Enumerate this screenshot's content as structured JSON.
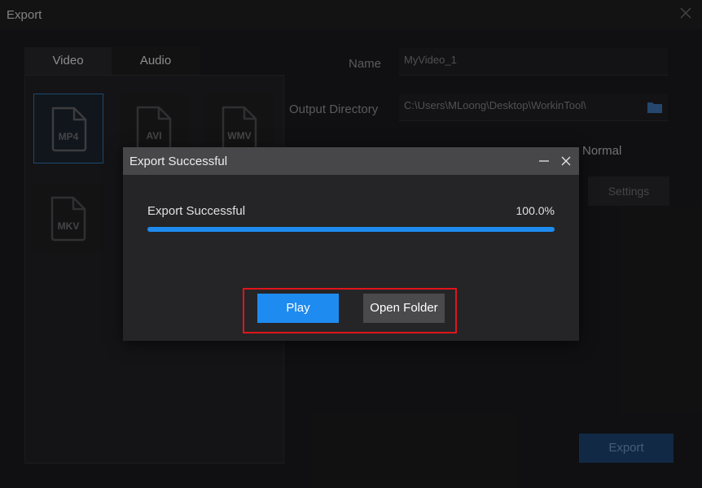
{
  "window": {
    "title": "Export"
  },
  "tabs": [
    {
      "label": "Video"
    },
    {
      "label": "Audio"
    }
  ],
  "formats": [
    {
      "label": "MP4",
      "selected": true
    },
    {
      "label": "AVI",
      "selected": false
    },
    {
      "label": "WMV",
      "selected": false
    },
    {
      "label": "MKV",
      "selected": false
    }
  ],
  "form": {
    "name_label": "Name",
    "name_value": "MyVideo_1",
    "output_label": "Output Directory",
    "output_value": "C:\\Users\\MLoong\\Desktop\\WorkinTool\\",
    "quality_value": "Normal",
    "settings_label": "Settings"
  },
  "export_label": "Export",
  "dialog": {
    "title": "Export Successful",
    "status": "Export Successful",
    "percent": "100.0%",
    "progress": 1.0,
    "play_label": "Play",
    "open_folder_label": "Open Folder"
  },
  "colors": {
    "accent": "#1e8bf0",
    "highlight": "#e0151b"
  }
}
